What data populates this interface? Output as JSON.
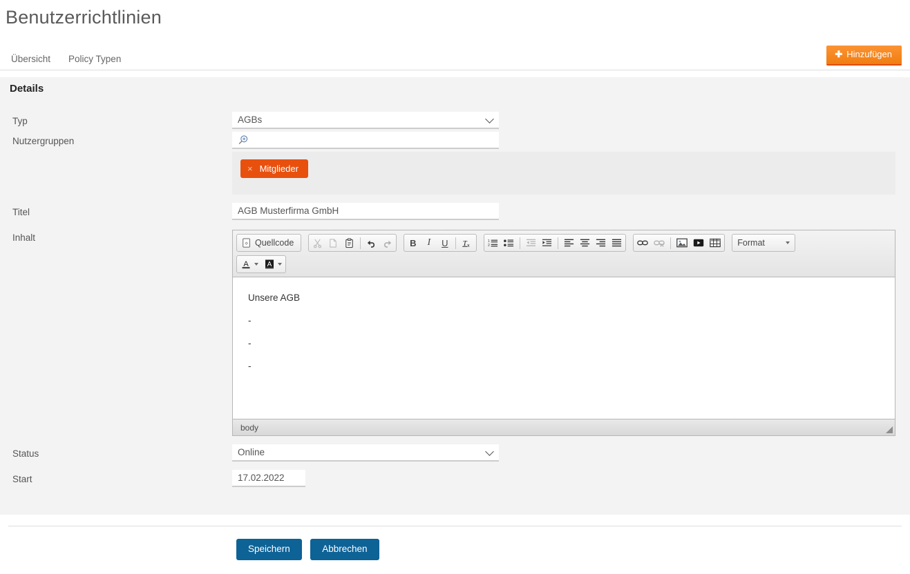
{
  "page": {
    "title": "Benutzerrichtlinien"
  },
  "tabs": [
    {
      "label": "Übersicht",
      "name": "tab-uebersicht"
    },
    {
      "label": "Policy Typen",
      "name": "tab-policy-typen"
    }
  ],
  "add_button": {
    "label": "Hinzufügen",
    "icon": "plus-icon",
    "glyph": "✚",
    "color": "#f58220"
  },
  "section": {
    "header": "Details"
  },
  "form": {
    "typ": {
      "label": "Typ",
      "value": "AGBs",
      "options": [
        "AGBs"
      ]
    },
    "nutzergruppen": {
      "label": "Nutzergruppen",
      "value": "",
      "placeholder": "",
      "icon": "search-plus-icon",
      "tags": [
        {
          "label": "Mitglieder",
          "remove_glyph": "×",
          "color": "#e8500e"
        }
      ]
    },
    "titel": {
      "label": "Titel",
      "value": "AGB Musterfirma GmbH",
      "placeholder": ""
    },
    "inhalt": {
      "label": "Inhalt",
      "editor": {
        "toolbar_row1": [
          {
            "name": "source-button",
            "icon": "source-code-icon",
            "label": "Quellcode",
            "type": "source",
            "disabled": false
          },
          {
            "name": "cut-button",
            "icon": "scissors-icon",
            "label": "",
            "type": "icon",
            "disabled": true
          },
          {
            "name": "copy-button",
            "icon": "copy-icon",
            "label": "",
            "type": "icon",
            "disabled": true
          },
          {
            "name": "paste-button",
            "icon": "clipboard-icon",
            "label": "",
            "type": "icon",
            "disabled": false
          },
          {
            "name": "undo-button",
            "icon": "undo-arrow-icon",
            "label": "",
            "type": "icon",
            "disabled": false
          },
          {
            "name": "redo-button",
            "icon": "redo-arrow-icon",
            "label": "",
            "type": "icon",
            "disabled": true
          },
          {
            "name": "bold-button",
            "icon": "bold-icon",
            "label": "B",
            "type": "text",
            "disabled": false
          },
          {
            "name": "italic-button",
            "icon": "italic-icon",
            "label": "I",
            "type": "text",
            "disabled": false
          },
          {
            "name": "underline-button",
            "icon": "underline-icon",
            "label": "U",
            "type": "text",
            "disabled": false
          },
          {
            "name": "remove-format-button",
            "icon": "remove-format-icon",
            "label": "",
            "type": "icon",
            "disabled": false
          },
          {
            "name": "numbered-list-button",
            "icon": "numbered-list-icon",
            "label": "",
            "type": "icon",
            "disabled": false
          },
          {
            "name": "bulleted-list-button",
            "icon": "bulleted-list-icon",
            "label": "",
            "type": "icon",
            "disabled": false
          },
          {
            "name": "outdent-button",
            "icon": "outdent-icon",
            "label": "",
            "type": "icon",
            "disabled": true
          },
          {
            "name": "indent-button",
            "icon": "indent-icon",
            "label": "",
            "type": "icon",
            "disabled": false
          },
          {
            "name": "align-left-button",
            "icon": "align-left-icon",
            "label": "",
            "type": "icon",
            "disabled": false
          },
          {
            "name": "align-center-button",
            "icon": "align-center-icon",
            "label": "",
            "type": "icon",
            "disabled": false
          },
          {
            "name": "align-right-button",
            "icon": "align-right-icon",
            "label": "",
            "type": "icon",
            "disabled": false
          },
          {
            "name": "align-justify-button",
            "icon": "align-justify-icon",
            "label": "",
            "type": "icon",
            "disabled": false
          },
          {
            "name": "link-button",
            "icon": "link-icon",
            "label": "",
            "type": "icon",
            "disabled": false
          },
          {
            "name": "unlink-button",
            "icon": "unlink-icon",
            "label": "",
            "type": "icon",
            "disabled": true
          },
          {
            "name": "image-button",
            "icon": "image-icon",
            "label": "",
            "type": "icon",
            "disabled": false
          },
          {
            "name": "video-button",
            "icon": "video-icon",
            "label": "",
            "type": "icon",
            "disabled": false
          },
          {
            "name": "table-button",
            "icon": "table-icon",
            "label": "",
            "type": "icon",
            "disabled": false
          }
        ],
        "format_combo": {
          "name": "format-combo",
          "label": "Format"
        },
        "toolbar_row2": [
          {
            "name": "text-color-button",
            "icon": "text-color-icon",
            "label": "A"
          },
          {
            "name": "background-color-button",
            "icon": "background-color-icon",
            "label": "A"
          }
        ],
        "content": [
          "Unsere AGB",
          "-",
          "-",
          "-"
        ],
        "element_path": "body"
      }
    },
    "status": {
      "label": "Status",
      "value": "Online",
      "options": [
        "Online"
      ]
    },
    "start": {
      "label": "Start",
      "value": "17.02.2022",
      "placeholder": ""
    }
  },
  "footer": {
    "save_label": "Speichern",
    "cancel_label": "Abbrechen",
    "button_color": "#0d6296"
  }
}
